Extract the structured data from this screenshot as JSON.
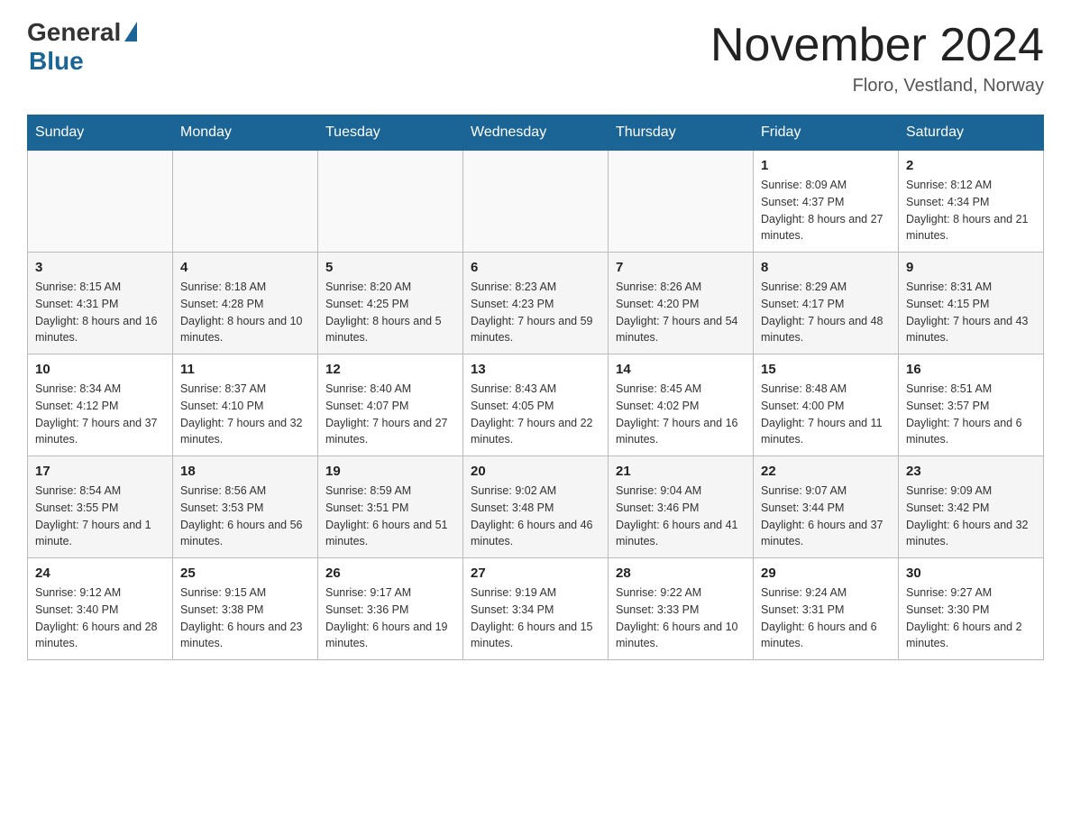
{
  "header": {
    "logo": {
      "general": "General",
      "blue": "Blue",
      "subtitle": ""
    },
    "month_title": "November 2024",
    "location": "Floro, Vestland, Norway"
  },
  "days_of_week": [
    "Sunday",
    "Monday",
    "Tuesday",
    "Wednesday",
    "Thursday",
    "Friday",
    "Saturday"
  ],
  "weeks": [
    [
      {
        "day": "",
        "sunrise": "",
        "sunset": "",
        "daylight": ""
      },
      {
        "day": "",
        "sunrise": "",
        "sunset": "",
        "daylight": ""
      },
      {
        "day": "",
        "sunrise": "",
        "sunset": "",
        "daylight": ""
      },
      {
        "day": "",
        "sunrise": "",
        "sunset": "",
        "daylight": ""
      },
      {
        "day": "",
        "sunrise": "",
        "sunset": "",
        "daylight": ""
      },
      {
        "day": "1",
        "sunrise": "Sunrise: 8:09 AM",
        "sunset": "Sunset: 4:37 PM",
        "daylight": "Daylight: 8 hours and 27 minutes."
      },
      {
        "day": "2",
        "sunrise": "Sunrise: 8:12 AM",
        "sunset": "Sunset: 4:34 PM",
        "daylight": "Daylight: 8 hours and 21 minutes."
      }
    ],
    [
      {
        "day": "3",
        "sunrise": "Sunrise: 8:15 AM",
        "sunset": "Sunset: 4:31 PM",
        "daylight": "Daylight: 8 hours and 16 minutes."
      },
      {
        "day": "4",
        "sunrise": "Sunrise: 8:18 AM",
        "sunset": "Sunset: 4:28 PM",
        "daylight": "Daylight: 8 hours and 10 minutes."
      },
      {
        "day": "5",
        "sunrise": "Sunrise: 8:20 AM",
        "sunset": "Sunset: 4:25 PM",
        "daylight": "Daylight: 8 hours and 5 minutes."
      },
      {
        "day": "6",
        "sunrise": "Sunrise: 8:23 AM",
        "sunset": "Sunset: 4:23 PM",
        "daylight": "Daylight: 7 hours and 59 minutes."
      },
      {
        "day": "7",
        "sunrise": "Sunrise: 8:26 AM",
        "sunset": "Sunset: 4:20 PM",
        "daylight": "Daylight: 7 hours and 54 minutes."
      },
      {
        "day": "8",
        "sunrise": "Sunrise: 8:29 AM",
        "sunset": "Sunset: 4:17 PM",
        "daylight": "Daylight: 7 hours and 48 minutes."
      },
      {
        "day": "9",
        "sunrise": "Sunrise: 8:31 AM",
        "sunset": "Sunset: 4:15 PM",
        "daylight": "Daylight: 7 hours and 43 minutes."
      }
    ],
    [
      {
        "day": "10",
        "sunrise": "Sunrise: 8:34 AM",
        "sunset": "Sunset: 4:12 PM",
        "daylight": "Daylight: 7 hours and 37 minutes."
      },
      {
        "day": "11",
        "sunrise": "Sunrise: 8:37 AM",
        "sunset": "Sunset: 4:10 PM",
        "daylight": "Daylight: 7 hours and 32 minutes."
      },
      {
        "day": "12",
        "sunrise": "Sunrise: 8:40 AM",
        "sunset": "Sunset: 4:07 PM",
        "daylight": "Daylight: 7 hours and 27 minutes."
      },
      {
        "day": "13",
        "sunrise": "Sunrise: 8:43 AM",
        "sunset": "Sunset: 4:05 PM",
        "daylight": "Daylight: 7 hours and 22 minutes."
      },
      {
        "day": "14",
        "sunrise": "Sunrise: 8:45 AM",
        "sunset": "Sunset: 4:02 PM",
        "daylight": "Daylight: 7 hours and 16 minutes."
      },
      {
        "day": "15",
        "sunrise": "Sunrise: 8:48 AM",
        "sunset": "Sunset: 4:00 PM",
        "daylight": "Daylight: 7 hours and 11 minutes."
      },
      {
        "day": "16",
        "sunrise": "Sunrise: 8:51 AM",
        "sunset": "Sunset: 3:57 PM",
        "daylight": "Daylight: 7 hours and 6 minutes."
      }
    ],
    [
      {
        "day": "17",
        "sunrise": "Sunrise: 8:54 AM",
        "sunset": "Sunset: 3:55 PM",
        "daylight": "Daylight: 7 hours and 1 minute."
      },
      {
        "day": "18",
        "sunrise": "Sunrise: 8:56 AM",
        "sunset": "Sunset: 3:53 PM",
        "daylight": "Daylight: 6 hours and 56 minutes."
      },
      {
        "day": "19",
        "sunrise": "Sunrise: 8:59 AM",
        "sunset": "Sunset: 3:51 PM",
        "daylight": "Daylight: 6 hours and 51 minutes."
      },
      {
        "day": "20",
        "sunrise": "Sunrise: 9:02 AM",
        "sunset": "Sunset: 3:48 PM",
        "daylight": "Daylight: 6 hours and 46 minutes."
      },
      {
        "day": "21",
        "sunrise": "Sunrise: 9:04 AM",
        "sunset": "Sunset: 3:46 PM",
        "daylight": "Daylight: 6 hours and 41 minutes."
      },
      {
        "day": "22",
        "sunrise": "Sunrise: 9:07 AM",
        "sunset": "Sunset: 3:44 PM",
        "daylight": "Daylight: 6 hours and 37 minutes."
      },
      {
        "day": "23",
        "sunrise": "Sunrise: 9:09 AM",
        "sunset": "Sunset: 3:42 PM",
        "daylight": "Daylight: 6 hours and 32 minutes."
      }
    ],
    [
      {
        "day": "24",
        "sunrise": "Sunrise: 9:12 AM",
        "sunset": "Sunset: 3:40 PM",
        "daylight": "Daylight: 6 hours and 28 minutes."
      },
      {
        "day": "25",
        "sunrise": "Sunrise: 9:15 AM",
        "sunset": "Sunset: 3:38 PM",
        "daylight": "Daylight: 6 hours and 23 minutes."
      },
      {
        "day": "26",
        "sunrise": "Sunrise: 9:17 AM",
        "sunset": "Sunset: 3:36 PM",
        "daylight": "Daylight: 6 hours and 19 minutes."
      },
      {
        "day": "27",
        "sunrise": "Sunrise: 9:19 AM",
        "sunset": "Sunset: 3:34 PM",
        "daylight": "Daylight: 6 hours and 15 minutes."
      },
      {
        "day": "28",
        "sunrise": "Sunrise: 9:22 AM",
        "sunset": "Sunset: 3:33 PM",
        "daylight": "Daylight: 6 hours and 10 minutes."
      },
      {
        "day": "29",
        "sunrise": "Sunrise: 9:24 AM",
        "sunset": "Sunset: 3:31 PM",
        "daylight": "Daylight: 6 hours and 6 minutes."
      },
      {
        "day": "30",
        "sunrise": "Sunrise: 9:27 AM",
        "sunset": "Sunset: 3:30 PM",
        "daylight": "Daylight: 6 hours and 2 minutes."
      }
    ]
  ]
}
